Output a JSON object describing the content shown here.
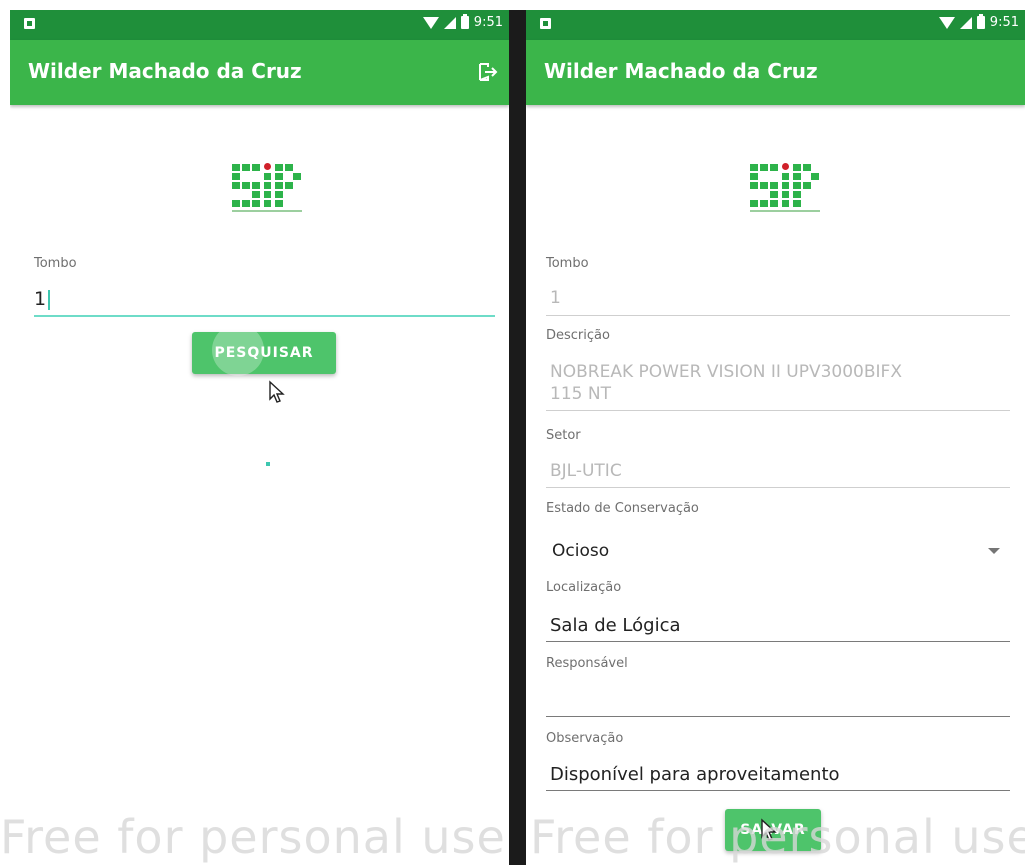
{
  "left": {
    "status_time": "9:51",
    "title": "Wilder Machado da Cruz",
    "tombo_label": "Tombo",
    "tombo_value": "1",
    "search_button": "PESQUISAR"
  },
  "right": {
    "status_time": "9:51",
    "title": "Wilder Machado da Cruz",
    "tombo_label": "Tombo",
    "tombo_value": "1",
    "descricao_label": "Descrição",
    "descricao_line1": "NOBREAK POWER VISION II UPV3000BIFX",
    "descricao_line2": "115 NT",
    "setor_label": "Setor",
    "setor_value": "BJL-UTIC",
    "estado_label": "Estado de Conservação",
    "estado_value": "Ocioso",
    "localizacao_label": "Localização",
    "localizacao_value": "Sala de Lógica",
    "responsavel_label": "Responsável",
    "responsavel_value": "",
    "observacao_label": "Observação",
    "observacao_value": "Disponível para aproveitamento",
    "save_button": "SALVAR"
  },
  "watermark": "Free for personal use",
  "colors": {
    "status_bar": "#1f8f3a",
    "app_bar": "#3bb54a",
    "button": "#4ec46b",
    "accent": "#6edcc8",
    "logo_green": "#2db34a",
    "logo_red": "#d0202a"
  },
  "icons": [
    "notification-icon",
    "wifi-icon",
    "signal-icon",
    "battery-icon",
    "logout-icon",
    "pointer-cursor-icon",
    "dropdown-arrow-icon"
  ]
}
